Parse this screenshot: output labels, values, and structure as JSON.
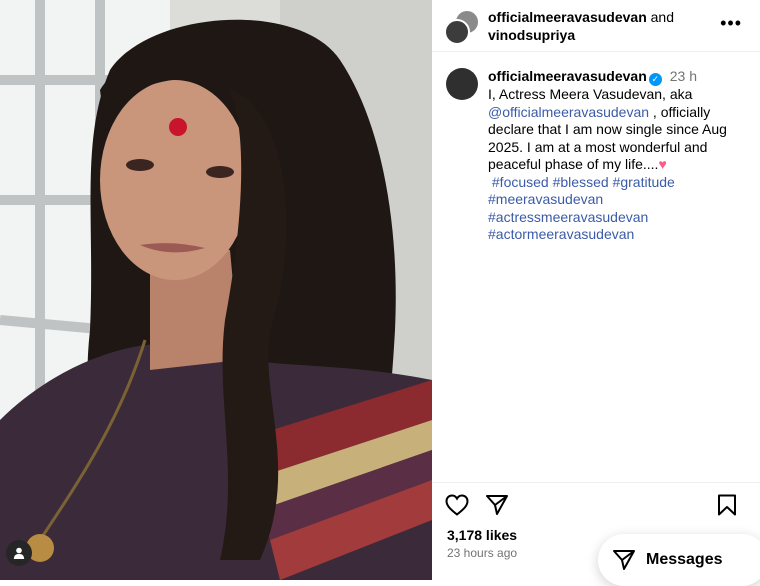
{
  "post": {
    "header": {
      "author": "officialmeeravasudevan",
      "conjunction": "and",
      "collaborator": "vinodsupriya"
    },
    "caption": {
      "username": "officialmeeravasudevan",
      "timestamp": "23 h",
      "text_line1": "I, Actress Meera Vasudevan, aka",
      "mention": "@officialmeeravasudevan",
      "text_line2": " , officially declare that I am now single since Aug 2025. I am at a most wonderful and peaceful phase of my life....",
      "heart": "♥",
      "hashtags_line1": [
        "#focused",
        "#blessed",
        "#gratitude"
      ],
      "hashtags": [
        "#meeravasudevan",
        "#actressmeeravasudevan",
        "#actormeeravasudevan"
      ]
    },
    "likes": "3,178 likes",
    "posted_ago": "23 hours ago"
  },
  "messages_button": {
    "label": "Messages"
  },
  "colors": {
    "link": "#3b5ba8",
    "verified": "#0095f6",
    "heart": "#ff5a8a"
  }
}
